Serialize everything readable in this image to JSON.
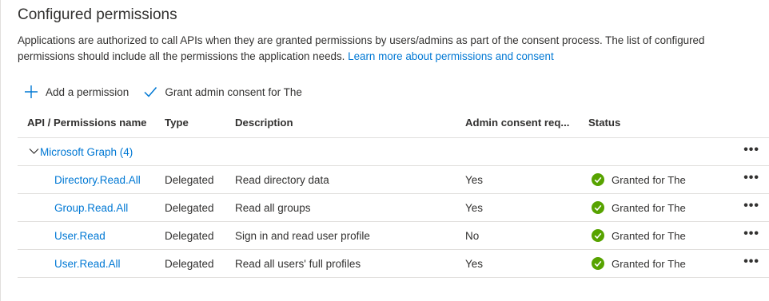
{
  "section": {
    "title": "Configured permissions",
    "description_text": "Applications are authorized to call APIs when they are granted permissions by users/admins as part of the consent process. The list of configured permissions should include all the permissions the application needs.",
    "learn_more_link": "Learn more about permissions and consent"
  },
  "toolbar": {
    "add_permission": "Add a permission",
    "grant_consent": "Grant admin consent for The"
  },
  "table": {
    "headers": {
      "api_name": "API / Permissions name",
      "type": "Type",
      "description": "Description",
      "admin_consent": "Admin consent req...",
      "status": "Status"
    },
    "group": {
      "label": "Microsoft Graph (4)"
    },
    "rows": [
      {
        "name": "Directory.Read.All",
        "type": "Delegated",
        "description": "Read directory data",
        "admin_consent": "Yes",
        "status": "Granted for The"
      },
      {
        "name": "Group.Read.All",
        "type": "Delegated",
        "description": "Read all groups",
        "admin_consent": "Yes",
        "status": "Granted for The"
      },
      {
        "name": "User.Read",
        "type": "Delegated",
        "description": "Sign in and read user profile",
        "admin_consent": "No",
        "status": "Granted for The"
      },
      {
        "name": "User.Read.All",
        "type": "Delegated",
        "description": "Read all users' full profiles",
        "admin_consent": "Yes",
        "status": "Granted for The"
      }
    ],
    "more_label": "•••"
  },
  "colors": {
    "accent": "#0078d4",
    "success": "#57a300",
    "border": "#e1dfdd",
    "text": "#323130"
  },
  "icons": {
    "add": "plus-icon",
    "grant": "checkmark-icon",
    "group_toggle": "chevron-down-icon",
    "status": "success-check-circle-icon",
    "more": "more-horizontal-icon"
  }
}
